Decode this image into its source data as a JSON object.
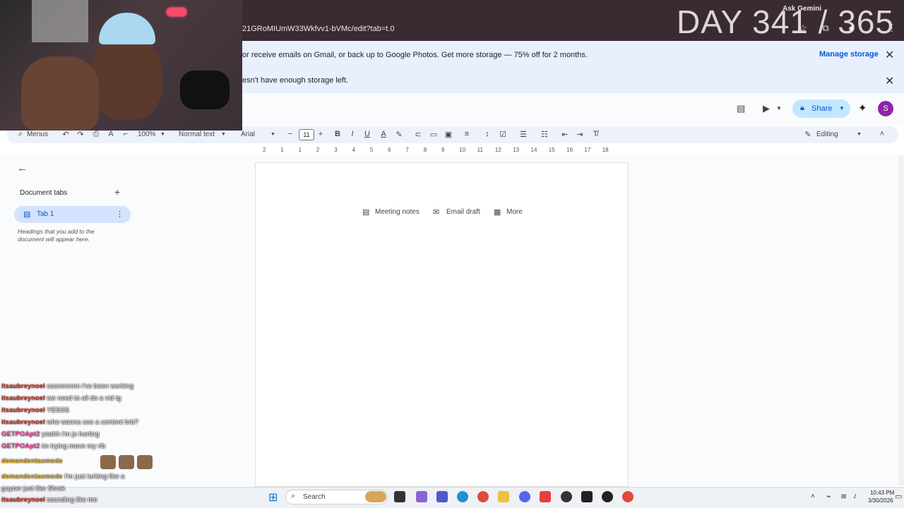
{
  "browser": {
    "url": "21GRoMIUmW33Wkfvv1-bVMc/edit?tab=t.0",
    "ask_gemini": "Ask Gemini"
  },
  "overlay": {
    "day_text": "DAY 341 / 365"
  },
  "banners": {
    "storage_text": "or receive emails on Gmail, or back up to Google Photos. Get more storage — 75% off for 2 months.",
    "manage_storage": "Manage storage",
    "not_enough_text": "esn't have enough storage left."
  },
  "header": {
    "share_label": "Share",
    "avatar_letter": "S"
  },
  "toolbar": {
    "menus_label": "Menus",
    "zoom": "100%",
    "style": "Normal text",
    "font": "Arial",
    "font_size": "11",
    "mode": "Editing"
  },
  "ruler": [
    "2",
    "1",
    "1",
    "2",
    "3",
    "4",
    "5",
    "6",
    "7",
    "8",
    "9",
    "10",
    "11",
    "12",
    "13",
    "14",
    "15",
    "16",
    "17",
    "18"
  ],
  "side_panel": {
    "title": "Document tabs",
    "tab_label": "Tab 1",
    "hint": "Headings that you add to the document will appear here."
  },
  "chips": {
    "meeting_notes": "Meeting notes",
    "email_draft": "Email draft",
    "more": "More"
  },
  "chat": [
    {
      "user": "itsaubreynoel",
      "msg": "soonnnnnn i've been working",
      "color": "#c0392b"
    },
    {
      "user": "itsaubreynoel",
      "msg": "we need to all do a vid tg",
      "color": "#c0392b"
    },
    {
      "user": "itsaubreynoel",
      "msg": "YESSS",
      "color": "#c0392b"
    },
    {
      "user": "itsaubreynoel",
      "msg": "who wanna see a content brb?",
      "color": "#c0392b"
    },
    {
      "user": "GETPOApt2",
      "msg": "yeahh i'm js hurting",
      "color": "#e84393"
    },
    {
      "user": "GETPOApt2",
      "msg": "im trying move my rib",
      "color": "#e84393"
    },
    {
      "user": "demandentasmode",
      "msg": "",
      "color": "#d4a017"
    },
    {
      "user": "demandentasmode",
      "msg": "I'm just lurking like a",
      "color": "#d4a017"
    },
    {
      "user": "",
      "msg": "guyzer just like Shrek",
      "color": "#ffffff"
    },
    {
      "user": "itsaubreynoel",
      "msg": "sounding like me",
      "color": "#c0392b"
    }
  ],
  "taskbar": {
    "search_label": "Search",
    "time": "10:43 PM",
    "date": "3/30/2026"
  },
  "colors": {
    "banner_bg": "#e8f0fe",
    "share_bg": "#c2e7ff",
    "accent": "#0b57d0",
    "avatar": "#8e24aa"
  }
}
